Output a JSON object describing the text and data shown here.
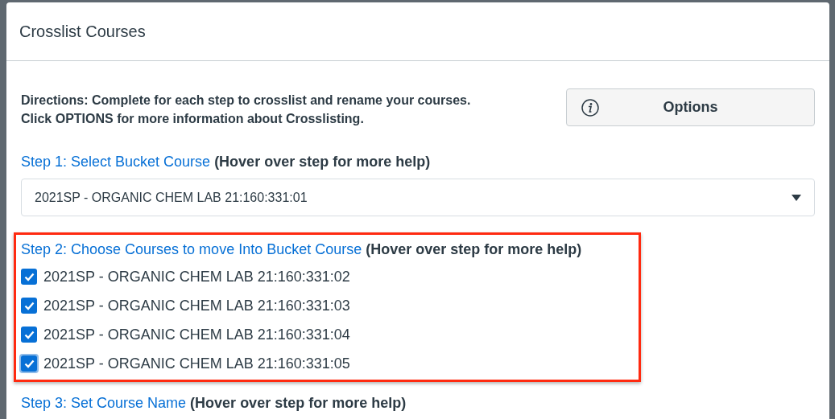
{
  "dialog": {
    "title": "Crosslist Courses"
  },
  "directions": [
    "Directions: Complete for each step to crosslist and rename your courses.",
    "Click OPTIONS for more information about Crosslisting."
  ],
  "options_button": {
    "label": "Options"
  },
  "steps": [
    {
      "kind": "select",
      "title": "Step 1: Select Bucket Course",
      "hint": "(Hover over step for more help)",
      "highlighted": false,
      "value": "2021SP - ORGANIC CHEM LAB 21:160:331:01"
    },
    {
      "kind": "checklist",
      "title": "Step 2: Choose Courses to move Into Bucket Course",
      "hint": "(Hover over step for more help)",
      "highlighted": true,
      "items": [
        {
          "label": "2021SP - ORGANIC CHEM LAB 21:160:331:02",
          "checked": true,
          "focused": false
        },
        {
          "label": "2021SP - ORGANIC CHEM LAB 21:160:331:03",
          "checked": true,
          "focused": false
        },
        {
          "label": "2021SP - ORGANIC CHEM LAB 21:160:331:04",
          "checked": true,
          "focused": false
        },
        {
          "label": "2021SP - ORGANIC CHEM LAB 21:160:331:05",
          "checked": true,
          "focused": true
        }
      ]
    },
    {
      "kind": "text",
      "title": "Step 3: Set Course Name",
      "hint": "(Hover over step for more help)",
      "highlighted": false
    }
  ]
}
